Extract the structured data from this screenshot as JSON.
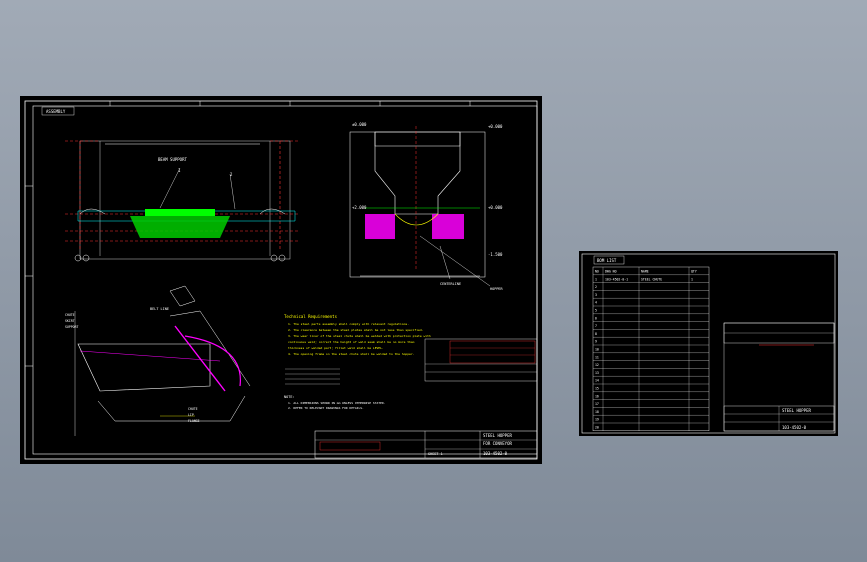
{
  "colors": {
    "background": "#8e98a6",
    "sheet": "#000000",
    "frame": "#ffffff",
    "green": "#00ff00",
    "magenta": "#ff00ff",
    "red": "#ff3030",
    "cyan": "#00ffff",
    "yellow": "#ffff00"
  },
  "main_sheet": {
    "title_tag": "ASSEMBLY",
    "front_view": {
      "callout_1": "1",
      "callout_2": "2",
      "note": "BEAM SUPPORT"
    },
    "section_view": {
      "label_top_left": "±0.000",
      "label_top_right": "+0.000",
      "label_mid_left": "+2.000",
      "label_mid_right": "+0.000",
      "label_bottom_right": "-1.500",
      "leader_1": "CENTERLINE",
      "leader_2": "HOPPER"
    },
    "side_view": {
      "label_top": "BELT LINE",
      "dims_left": [
        "CHUTE",
        "SKIRT",
        "SUPPORT"
      ],
      "dims_bottom": [
        "CHUTE",
        "LIP",
        "FLANGE"
      ]
    },
    "technical_requirements": {
      "title": "Technical Requirements",
      "lines": [
        "1. The steel parts assembly shall comply with relevant regulations.",
        "2. The clearance between the steel plates shall be not less than specified.",
        "3. The wear liner of the steel chute shall be welded with protection plate with",
        "   continuous weld; correct the height of weld seam shall be no more than",
        "   thickness of welded part; fillet weld shall be LEVEL.",
        "4. The opening frame on the steel chute shall be welded to the hopper."
      ]
    },
    "notes_title": "NOTE:",
    "notes": [
      "1. ALL DIMENSIONS SHOWN IN mm UNLESS OTHERWISE STATED.",
      "2. REFER TO RELEVANT DRAWINGS FOR DETAILS."
    ],
    "title_block": {
      "drawing_no": "103-4502-0",
      "sheet": "SHEET 1",
      "title_line_1": "STEEL HOPPER",
      "title_line_2": "FOR CONVEYOR"
    }
  },
  "bom_sheet": {
    "title_tag": "BOM LIST",
    "headers": [
      "NO",
      "DWG NO",
      "NAME",
      "QTY"
    ],
    "rows": [
      [
        "1",
        "103-4502-0-1",
        "STEEL CHUTE",
        "1"
      ],
      [
        "2",
        "",
        "",
        ""
      ],
      [
        "3",
        "",
        "",
        ""
      ],
      [
        "4",
        "",
        "",
        ""
      ],
      [
        "5",
        "",
        "",
        ""
      ],
      [
        "6",
        "",
        "",
        ""
      ],
      [
        "7",
        "",
        "",
        ""
      ],
      [
        "8",
        "",
        "",
        ""
      ],
      [
        "9",
        "",
        "",
        ""
      ],
      [
        "10",
        "",
        "",
        ""
      ],
      [
        "11",
        "",
        "",
        ""
      ],
      [
        "12",
        "",
        "",
        ""
      ],
      [
        "13",
        "",
        "",
        ""
      ],
      [
        "14",
        "",
        "",
        ""
      ],
      [
        "15",
        "",
        "",
        ""
      ],
      [
        "16",
        "",
        "",
        ""
      ],
      [
        "17",
        "",
        "",
        ""
      ],
      [
        "18",
        "",
        "",
        ""
      ],
      [
        "19",
        "",
        "",
        ""
      ],
      [
        "20",
        "",
        "",
        ""
      ]
    ],
    "title_block": {
      "drawing_no": "103-4502-0",
      "title": "STEEL HOPPER"
    }
  }
}
